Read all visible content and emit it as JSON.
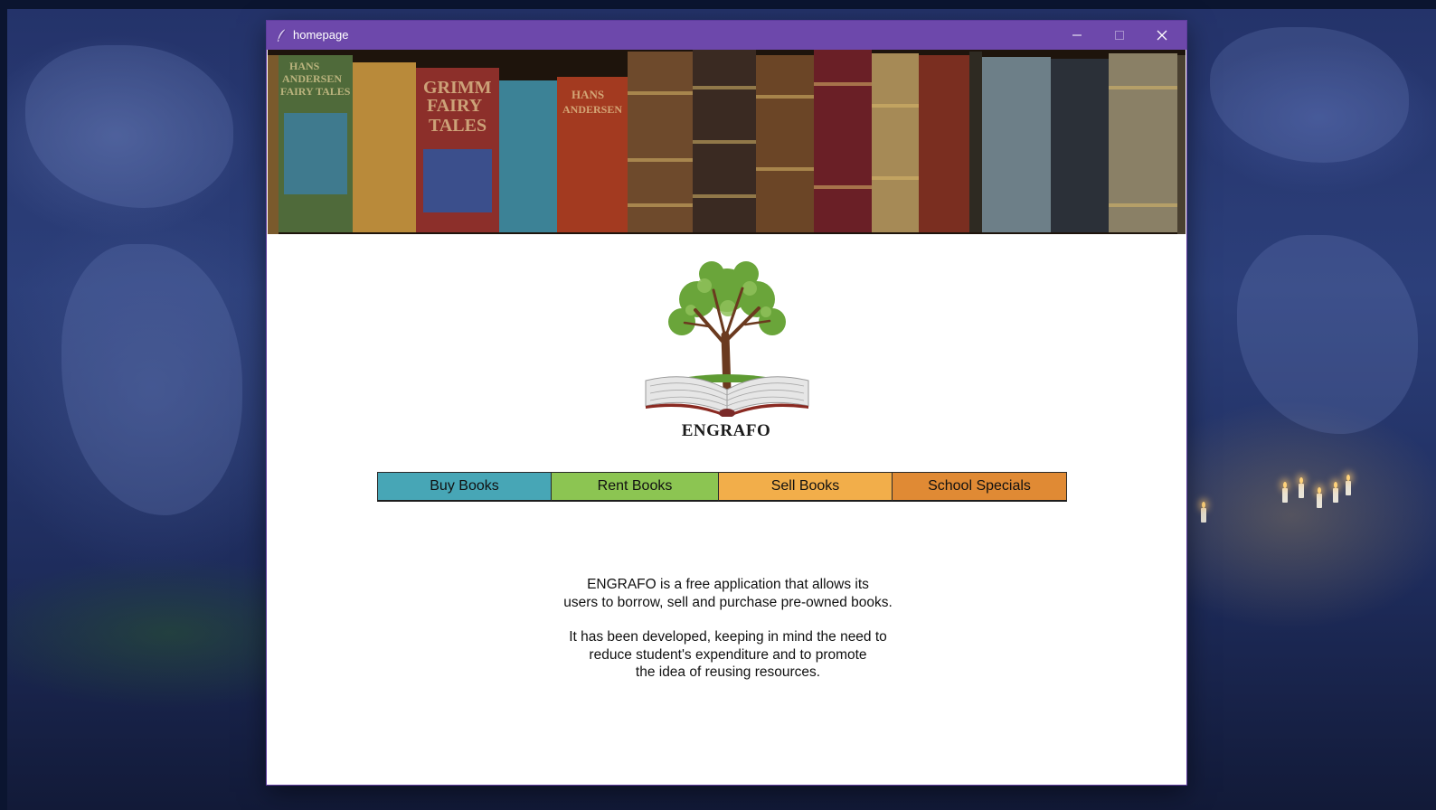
{
  "window": {
    "title": "homepage"
  },
  "app": {
    "brand_name": "ENGRAFO",
    "logo_icon": "tree-book-logo",
    "banner_image": "antique-books-banner"
  },
  "buttons": [
    {
      "label": "Buy Books",
      "color": "#47a6b6"
    },
    {
      "label": "Rent Books",
      "color": "#8cc552"
    },
    {
      "label": "Sell Books",
      "color": "#f2ae4a"
    },
    {
      "label": "School Specials",
      "color": "#e08a34"
    }
  ],
  "description": {
    "line1": "ENGRAFO is a free application that allows its",
    "line2": "users to borrow, sell and purchase pre-owned books.",
    "line3": "It has been developed, keeping in mind the need to",
    "line4": "reduce student's expenditure and to promote",
    "line5": "the idea of reusing resources."
  },
  "colors": {
    "titlebar": "#6d48ab",
    "window_bg": "#ffffff"
  }
}
